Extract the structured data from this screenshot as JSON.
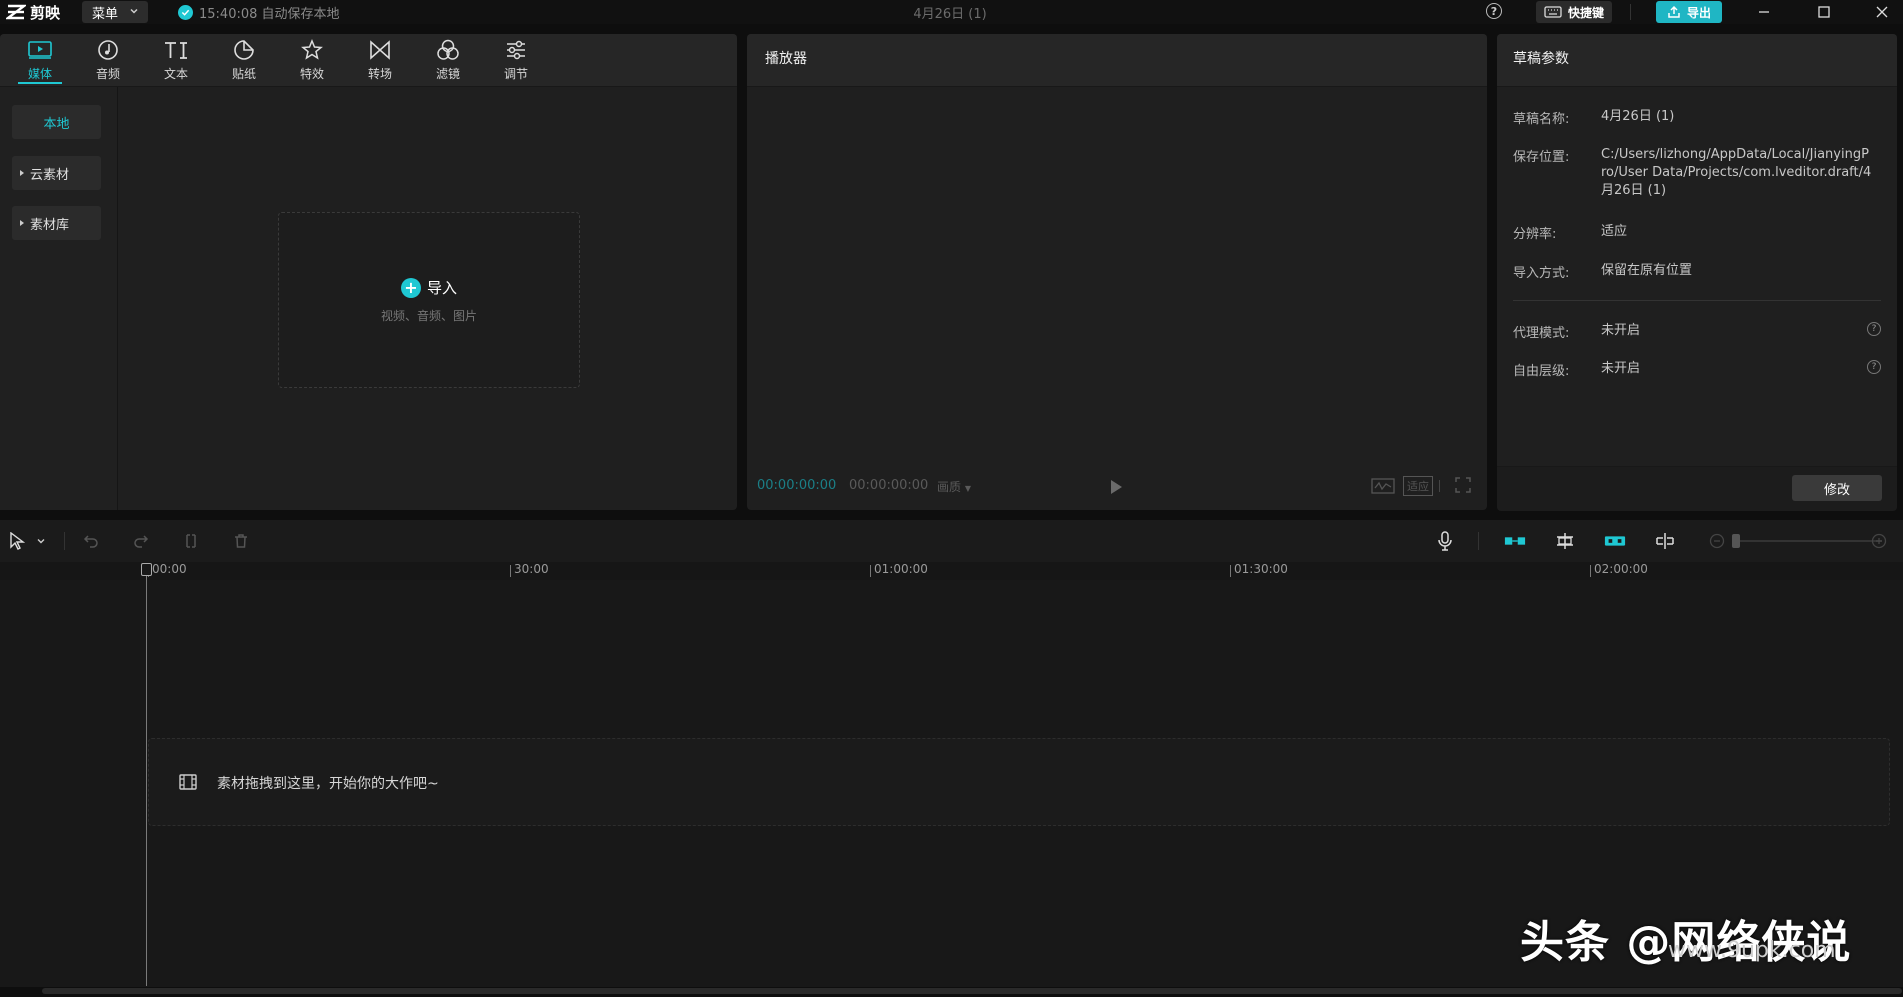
{
  "app": {
    "logo_text": "剪映",
    "menu_label": "菜单",
    "save_status": "15:40:08 自动保存本地",
    "document_title": "4月26日 (1)",
    "shortcut_label": "快捷键",
    "export_label": "导出"
  },
  "colors": {
    "accent": "#1fc8d3"
  },
  "media": {
    "tabs": [
      {
        "label": "媒体",
        "icon": "media-play-icon"
      },
      {
        "label": "音频",
        "icon": "audio-note-icon"
      },
      {
        "label": "文本",
        "icon": "text-TI-icon"
      },
      {
        "label": "贴纸",
        "icon": "sticker-icon"
      },
      {
        "label": "特效",
        "icon": "star-effect-icon"
      },
      {
        "label": "转场",
        "icon": "transition-bowtie-icon"
      },
      {
        "label": "滤镜",
        "icon": "filter-circles-icon"
      },
      {
        "label": "调节",
        "icon": "adjust-sliders-icon"
      }
    ],
    "sidebar": [
      {
        "label": "本地"
      },
      {
        "label": "云素材"
      },
      {
        "label": "素材库"
      }
    ],
    "import_label": "导入",
    "import_sub": "视频、音频、图片"
  },
  "player": {
    "title": "播放器",
    "timecode_current": "00:00:00:00",
    "timecode_total": "00:00:00:00",
    "quality": "画质",
    "ratio_label": "适应"
  },
  "draft": {
    "title": "草稿参数",
    "props": [
      {
        "label": "草稿名称:",
        "value": "4月26日 (1)"
      },
      {
        "label": "保存位置:",
        "value": "C:/Users/lizhong/AppData/Local/JianyingPro/User Data/Projects/com.lveditor.draft/4月26日 (1)"
      },
      {
        "label": "分辨率:",
        "value": "适应"
      },
      {
        "label": "导入方式:",
        "value": "保留在原有位置"
      },
      {
        "label": "代理模式:",
        "value": "未开启"
      },
      {
        "label": "自由层级:",
        "value": "未开启"
      }
    ],
    "modify_label": "修改"
  },
  "timeline": {
    "ruler": [
      "00:00",
      "30:00",
      "01:00:00",
      "01:30:00",
      "02:00:00"
    ],
    "drop_text": "素材拖拽到这里，开始你的大作吧~"
  },
  "watermark": {
    "text": "头条 @网络侠说",
    "small": "www.9upk.com"
  }
}
